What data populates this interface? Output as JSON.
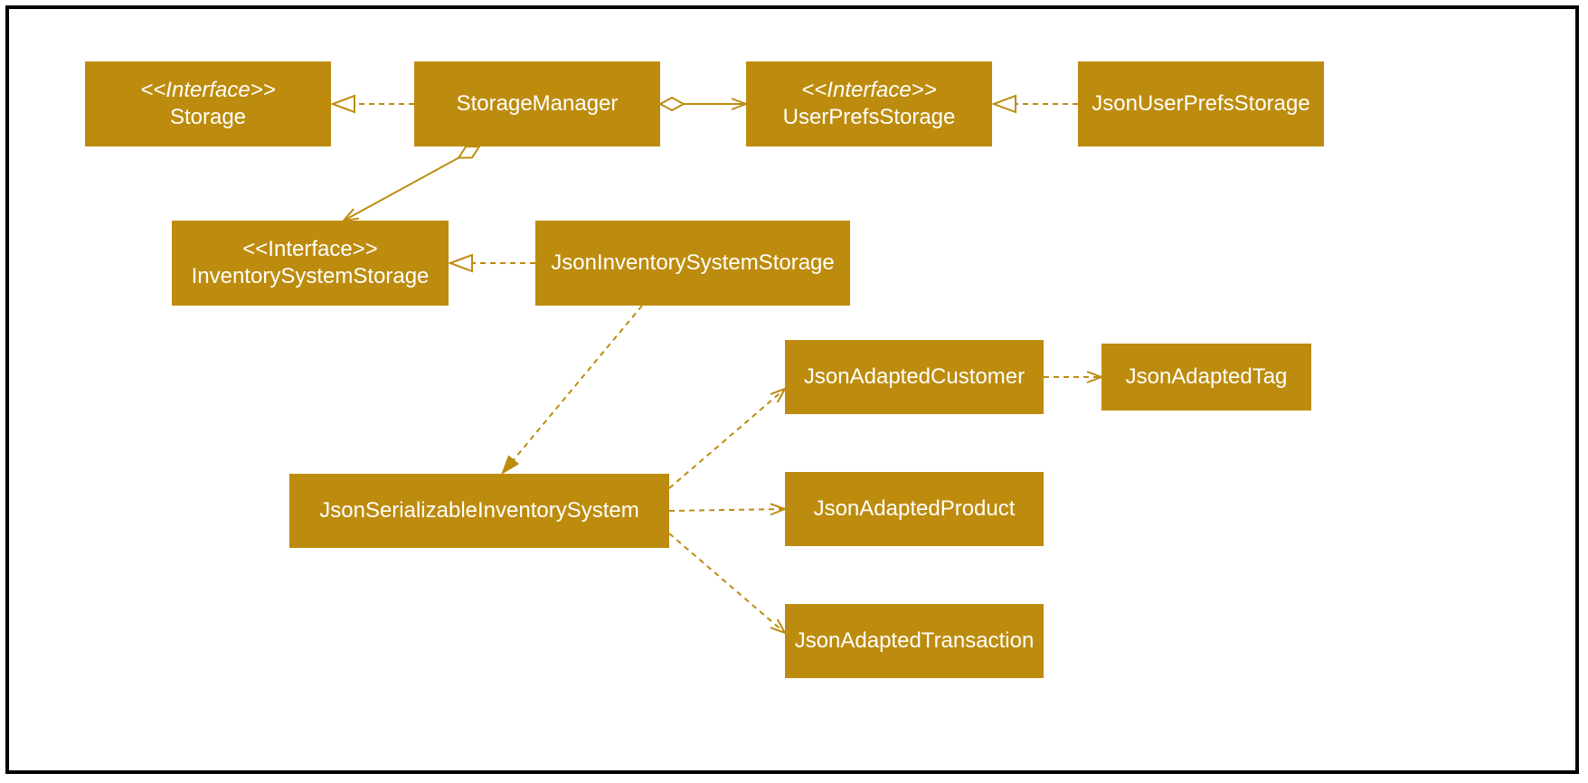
{
  "colors": {
    "fill": "#BD8C0E",
    "stroke": "#BD8C0E",
    "text": "#FFFFFF"
  },
  "nodes": {
    "storage": {
      "stereotype": "<<Interface>>",
      "name": "Storage"
    },
    "storageManager": {
      "name": "StorageManager"
    },
    "userPrefsStorage": {
      "stereotype": "<<Interface>>",
      "name": "UserPrefsStorage"
    },
    "jsonUserPrefs": {
      "name": "JsonUserPrefsStorage"
    },
    "invSysStorage": {
      "stereotype": "<<Interface>>",
      "name": "InventorySystemStorage"
    },
    "jsonInvSysStorage": {
      "name": "JsonInventorySystemStorage"
    },
    "jsonSerializable": {
      "name": "JsonSerializableInventorySystem"
    },
    "adaptedCustomer": {
      "name": "JsonAdaptedCustomer"
    },
    "adaptedProduct": {
      "name": "JsonAdaptedProduct"
    },
    "adaptedTransaction": {
      "name": "JsonAdaptedTransaction"
    },
    "adaptedTag": {
      "name": "JsonAdaptedTag"
    }
  },
  "relations": [
    {
      "from": "storageManager",
      "to": "storage",
      "type": "realization"
    },
    {
      "from": "storageManager",
      "to": "userPrefsStorage",
      "type": "aggregation"
    },
    {
      "from": "jsonUserPrefs",
      "to": "userPrefsStorage",
      "type": "realization"
    },
    {
      "from": "storageManager",
      "to": "invSysStorage",
      "type": "aggregation"
    },
    {
      "from": "jsonInvSysStorage",
      "to": "invSysStorage",
      "type": "realization"
    },
    {
      "from": "jsonInvSysStorage",
      "to": "jsonSerializable",
      "type": "dependency"
    },
    {
      "from": "jsonSerializable",
      "to": "adaptedCustomer",
      "type": "dependency"
    },
    {
      "from": "jsonSerializable",
      "to": "adaptedProduct",
      "type": "dependency"
    },
    {
      "from": "jsonSerializable",
      "to": "adaptedTransaction",
      "type": "dependency"
    },
    {
      "from": "adaptedCustomer",
      "to": "adaptedTag",
      "type": "dependency"
    }
  ]
}
